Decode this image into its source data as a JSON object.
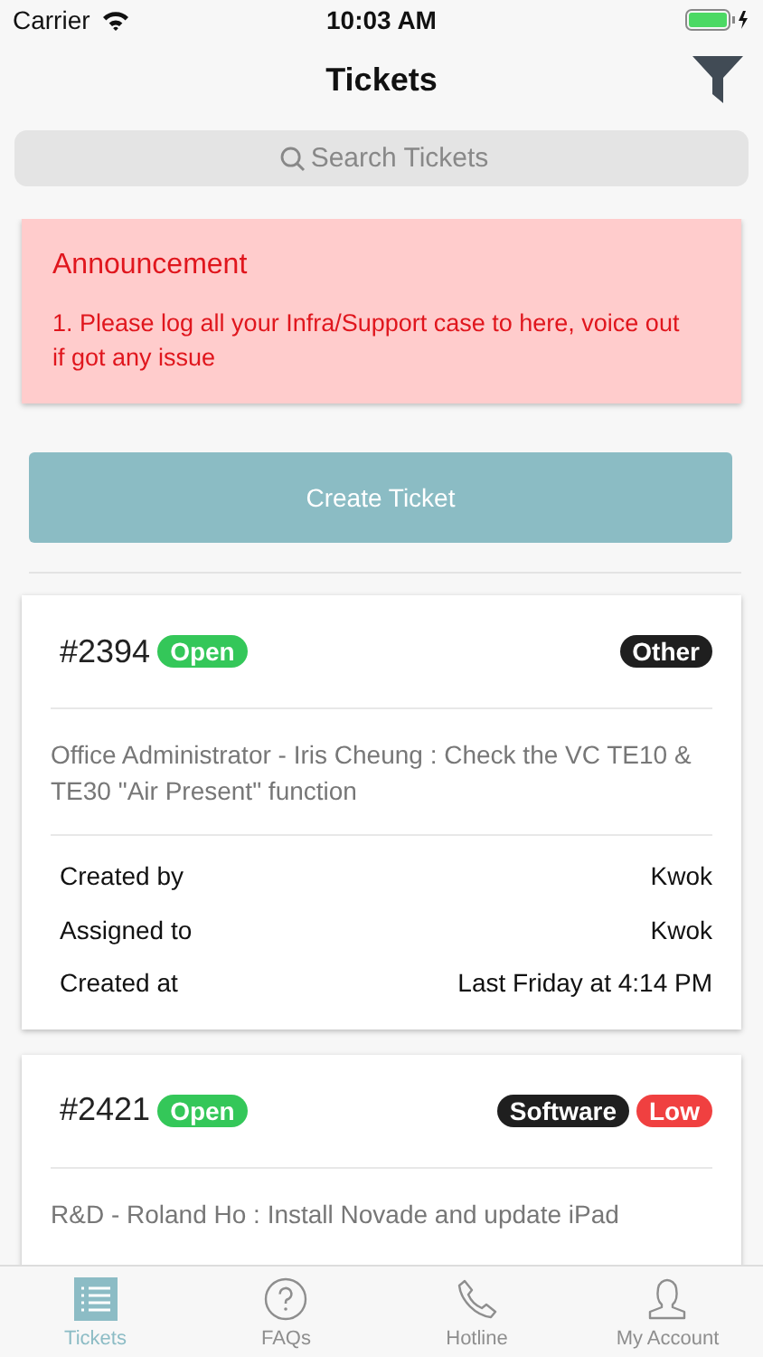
{
  "status_bar": {
    "carrier": "Carrier",
    "time": "10:03 AM"
  },
  "nav": {
    "title": "Tickets"
  },
  "search": {
    "placeholder": "Search Tickets"
  },
  "announcement": {
    "title": "Announcement",
    "text": "1. Please log all your Infra/Support case to here, voice out if got any issue"
  },
  "create_button": "Create Ticket",
  "tickets": [
    {
      "number": "#2394",
      "status": {
        "label": "Open",
        "color": "#34c759"
      },
      "tags": [
        {
          "label": "Other",
          "color": "#1f1f1f"
        }
      ],
      "description": "Office Administrator - Iris Cheung : Check the VC TE10 & TE30 \"Air Present\" function",
      "details": [
        {
          "label": "Created by",
          "value": "Kwok"
        },
        {
          "label": "Assigned to",
          "value": "Kwok"
        },
        {
          "label": "Created at",
          "value": "Last Friday at 4:14 PM"
        }
      ]
    },
    {
      "number": "#2421",
      "status": {
        "label": "Open",
        "color": "#34c759"
      },
      "tags": [
        {
          "label": "Software",
          "color": "#1f1f1f"
        },
        {
          "label": "Low",
          "color": "#f04040"
        }
      ],
      "description": "R&D - Roland Ho : Install Novade and update iPad"
    }
  ],
  "tab_bar": [
    {
      "label": "Tickets",
      "kind": "list",
      "selected": true
    },
    {
      "label": "FAQs",
      "kind": "question",
      "selected": false
    },
    {
      "label": "Hotline",
      "kind": "phone",
      "selected": false
    },
    {
      "label": "My Account",
      "kind": "person",
      "selected": false
    }
  ]
}
